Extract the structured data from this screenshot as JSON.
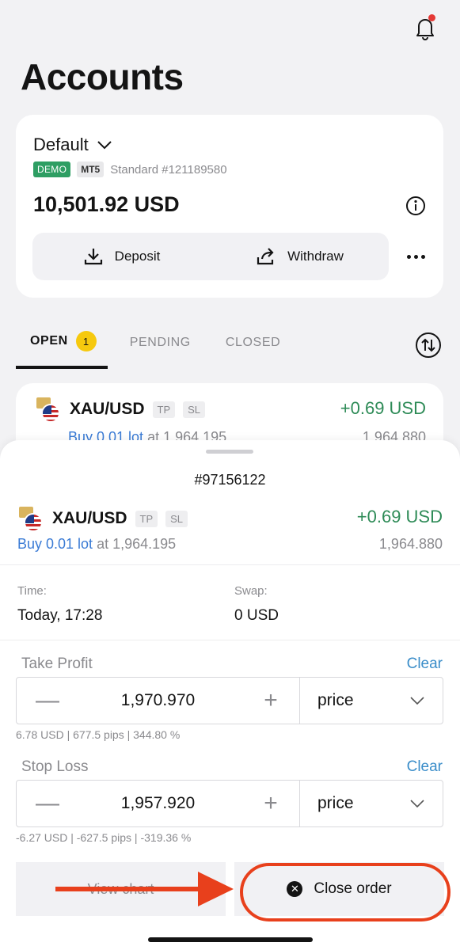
{
  "header": {
    "title": "Accounts",
    "notification_dot": true
  },
  "account": {
    "name": "Default",
    "badge_env": "DEMO",
    "badge_platform": "MT5",
    "type_line": "Standard #121189580",
    "balance": "10,501.92 USD",
    "deposit_label": "Deposit",
    "withdraw_label": "Withdraw"
  },
  "tabs": {
    "open_label": "OPEN",
    "open_count": "1",
    "pending_label": "PENDING",
    "closed_label": "CLOSED"
  },
  "position": {
    "symbol": "XAU/USD",
    "tag_tp": "TP",
    "tag_sl": "SL",
    "pnl": "+0.69 USD",
    "buy_text": "Buy 0.01 lot",
    "at_text": "at 1,964.195",
    "current_price": "1,964.880"
  },
  "sheet": {
    "order_id": "#97156122",
    "symbol": "XAU/USD",
    "tag_tp": "TP",
    "tag_sl": "SL",
    "pnl": "+0.69 USD",
    "buy_text": "Buy 0.01 lot",
    "at_text": "at 1,964.195",
    "current_price": "1,964.880",
    "time_label": "Time:",
    "time_value": "Today, 17:28",
    "swap_label": "Swap:",
    "swap_value": "0 USD",
    "take_profit": {
      "label": "Take Profit",
      "clear": "Clear",
      "value": "1,970.970",
      "unit": "price",
      "hint": "6.78 USD | 677.5 pips | 344.80 %"
    },
    "stop_loss": {
      "label": "Stop Loss",
      "clear": "Clear",
      "value": "1,957.920",
      "unit": "price",
      "hint": "-6.27 USD | -627.5 pips | -319.36 %"
    },
    "view_chart_label": "View chart",
    "close_order_label": "Close order"
  },
  "colors": {
    "profit": "#2e8b57",
    "link": "#3a7bd5",
    "demo_badge": "#2e9e63",
    "annotation": "#e8401c",
    "count_badge": "#f6c90e"
  }
}
